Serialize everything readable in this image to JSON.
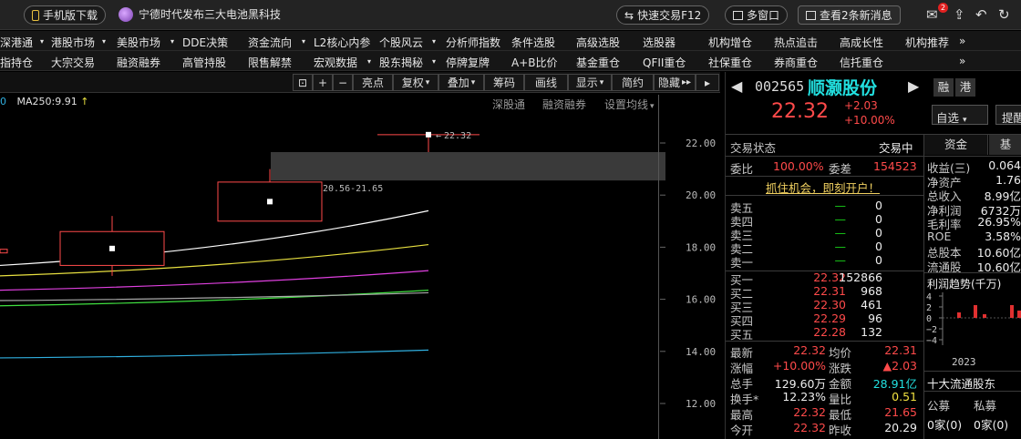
{
  "topbar": {
    "mobile_download": "手机版下载",
    "news_headline": "宁德时代发布三大电池黑科技",
    "quick_trade": "快速交易F12",
    "multi_window": "多窗口",
    "view_news": "查看2条新消息",
    "mail_badge": "2"
  },
  "menu_row1": [
    "深港通",
    "港股市场",
    "美股市场",
    "DDE决策",
    "资金流向",
    "L2核心内参",
    "个股风云",
    "分析师指数",
    "条件选股",
    "高级选股",
    "选股器",
    "机构增仓",
    "热点追击",
    "高成长性",
    "机构推荐"
  ],
  "menu_row2": [
    "指持仓",
    "大宗交易",
    "融资融券",
    "高管持股",
    "限售解禁",
    "宏观数据",
    "股东揭秘",
    "停牌复牌",
    "A+B比价",
    "基金重仓",
    "QFII重仓",
    "社保重仓",
    "券商重仓",
    "信托重仓"
  ],
  "more_glyph": "»",
  "toolbar": {
    "highlight": "亮点",
    "restore_rights": "复权",
    "overlay": "叠加",
    "chips": "筹码",
    "draw_line": "画线",
    "display": "显示",
    "simple": "简约",
    "hide": "隐藏"
  },
  "chart": {
    "ma_label": "MA250:9.91",
    "ma_prefix": "0",
    "links": [
      "深股通",
      "融资融券",
      "设置均线"
    ],
    "yticks": [
      "22.00",
      "20.00",
      "18.00",
      "16.00",
      "14.00",
      "12.00"
    ],
    "high_annot": "22.32",
    "gap_annot": "20.56-21.65"
  },
  "chart_data": {
    "type": "candlestick",
    "ylim": [
      11.5,
      22.6
    ],
    "yticks": [
      22.0,
      20.0,
      18.0,
      16.0,
      14.0,
      12.0
    ],
    "candles": [
      {
        "open": 17.3,
        "close": 18.6,
        "high": 19.2,
        "low": 16.9
      },
      {
        "open": 19.0,
        "close": 20.5,
        "high": 21.0,
        "low": 19.0
      },
      {
        "open": 22.32,
        "close": 22.32,
        "high": 22.32,
        "low": 21.65
      }
    ],
    "gap_range": [
      20.56,
      21.65
    ],
    "ma_lines": [
      {
        "color": "#ffffff",
        "start": 17.3,
        "end": 19.4
      },
      {
        "color": "#e8e040",
        "start": 16.9,
        "end": 18.1
      },
      {
        "color": "#e040e0",
        "start": 16.35,
        "end": 17.1
      },
      {
        "color": "#40e040",
        "start": 15.75,
        "end": 16.35
      },
      {
        "color": "#aaaaaa",
        "start": 15.95,
        "end": 16.25
      },
      {
        "color": "#30b0e0",
        "start": 13.75,
        "end": 14.05
      }
    ]
  },
  "stock": {
    "code": "002565",
    "name": "顺灏股份",
    "tag_rong": "融",
    "tag_gang": "港",
    "price": "22.32",
    "change": "+2.03",
    "change_pct": "+10.00%",
    "watchlist": "自选",
    "remind": "提醒"
  },
  "trade": {
    "status_label": "交易状态",
    "status_value": "交易中",
    "weibi_label": "委比",
    "weibi_value": "100.00%",
    "weicha_label": "委差",
    "weicha_value": "154523",
    "open_account": "抓住机会，即刻开户！",
    "sells": [
      {
        "label": "卖五",
        "price": "—",
        "vol": "0"
      },
      {
        "label": "卖四",
        "price": "—",
        "vol": "0"
      },
      {
        "label": "卖三",
        "price": "—",
        "vol": "0"
      },
      {
        "label": "卖二",
        "price": "—",
        "vol": "0"
      },
      {
        "label": "卖一",
        "price": "—",
        "vol": "0"
      }
    ],
    "buys": [
      {
        "label": "买一",
        "price": "22.32",
        "vol": "152866"
      },
      {
        "label": "买二",
        "price": "22.31",
        "vol": "968"
      },
      {
        "label": "买三",
        "price": "22.30",
        "vol": "461"
      },
      {
        "label": "买四",
        "price": "22.29",
        "vol": "96"
      },
      {
        "label": "买五",
        "price": "22.28",
        "vol": "132"
      }
    ],
    "stats": [
      {
        "l1": "最新",
        "v1": "22.32",
        "c1": "red",
        "l2": "均价",
        "v2": "22.31",
        "c2": "red"
      },
      {
        "l1": "涨幅",
        "v1": "+10.00%",
        "c1": "red",
        "l2": "涨跌",
        "v2": "▲2.03",
        "c2": "red"
      },
      {
        "l1": "总手",
        "v1": "129.60万",
        "c1": "white",
        "l2": "金额",
        "v2": "28.91亿",
        "c2": "cyan"
      },
      {
        "l1": "换手*",
        "v1": "12.23%",
        "c1": "white",
        "l2": "量比",
        "v2": "0.51",
        "c2": "yellow"
      },
      {
        "l1": "最高",
        "v1": "22.32",
        "c1": "red",
        "l2": "最低",
        "v2": "21.65",
        "c2": "red"
      },
      {
        "l1": "今开",
        "v1": "22.32",
        "c1": "red",
        "l2": "昨收",
        "v2": "20.29",
        "c2": "white"
      }
    ]
  },
  "fund": {
    "tab_funds": "资金",
    "tab_basic": "基",
    "items": [
      {
        "label": "收益(三)",
        "value": "0.064"
      },
      {
        "label": "净资产",
        "value": "1.76"
      },
      {
        "label": "总收入",
        "value": "8.99亿"
      },
      {
        "label": "净利润",
        "value": "6732万"
      },
      {
        "label": "毛利率",
        "value": "26.95%"
      },
      {
        "label": "ROE",
        "value": "3.58%"
      },
      {
        "label": "总股本",
        "value": "10.60亿"
      },
      {
        "label": "流通股",
        "value": "10.60亿"
      }
    ],
    "profit_title": "利润趋势(千万)",
    "profit_yticks": [
      "4",
      "2",
      "0",
      "−2",
      "−4"
    ],
    "profit_year": "2023",
    "top10_title": "十大流通股东",
    "col_public": "公募",
    "col_private": "私募",
    "public_count": "0家(0)",
    "private_count": "0家(0)"
  }
}
